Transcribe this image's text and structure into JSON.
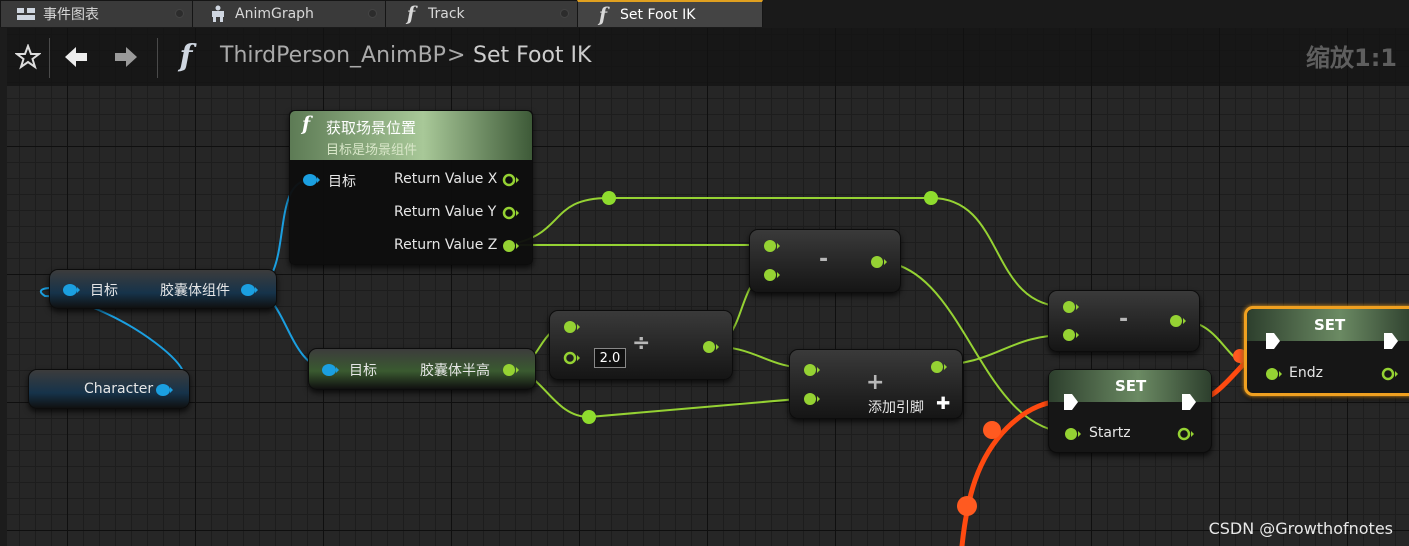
{
  "tabs": [
    {
      "label": "事件图表",
      "icon": "event-graph-icon"
    },
    {
      "label": "AnimGraph",
      "icon": "anim-graph-icon"
    },
    {
      "label": "Track",
      "icon": "function-icon"
    },
    {
      "label": "Set Foot IK",
      "icon": "function-icon"
    }
  ],
  "toolbar": {
    "breadcrumb_blueprint": "ThirdPerson_AnimBP",
    "breadcrumb_separator": ">",
    "breadcrumb_function": "Set Foot IK",
    "zoom": "缩放1:1"
  },
  "nodes": {
    "get_world_location": {
      "title": "获取场景位置",
      "subtitle": "目标是场景组件",
      "input_target": "目标",
      "out_x": "Return Value X",
      "out_y": "Return Value Y",
      "out_z": "Return Value Z"
    },
    "capsule_component": {
      "input": "目标",
      "output": "胶囊体组件"
    },
    "character": {
      "label": "Character"
    },
    "half_height": {
      "input": "目标",
      "output": "胶囊体半高"
    },
    "divide": {
      "symbol": "÷",
      "literal": "2.0"
    },
    "subtract1": {
      "symbol": "-"
    },
    "subtract2": {
      "symbol": "-"
    },
    "add": {
      "symbol": "+",
      "add_pin": "添加引脚"
    },
    "set_startz": {
      "title": "SET",
      "var": "Startz"
    },
    "set_endz": {
      "title": "SET",
      "var": "Endz"
    }
  },
  "colors": {
    "float_wire": "#95d233",
    "object_wire": "#1b9fe0",
    "exec_active": "#ff5010",
    "selected_border": "#f0a020"
  },
  "watermark": "CSDN @Growthofnotes"
}
